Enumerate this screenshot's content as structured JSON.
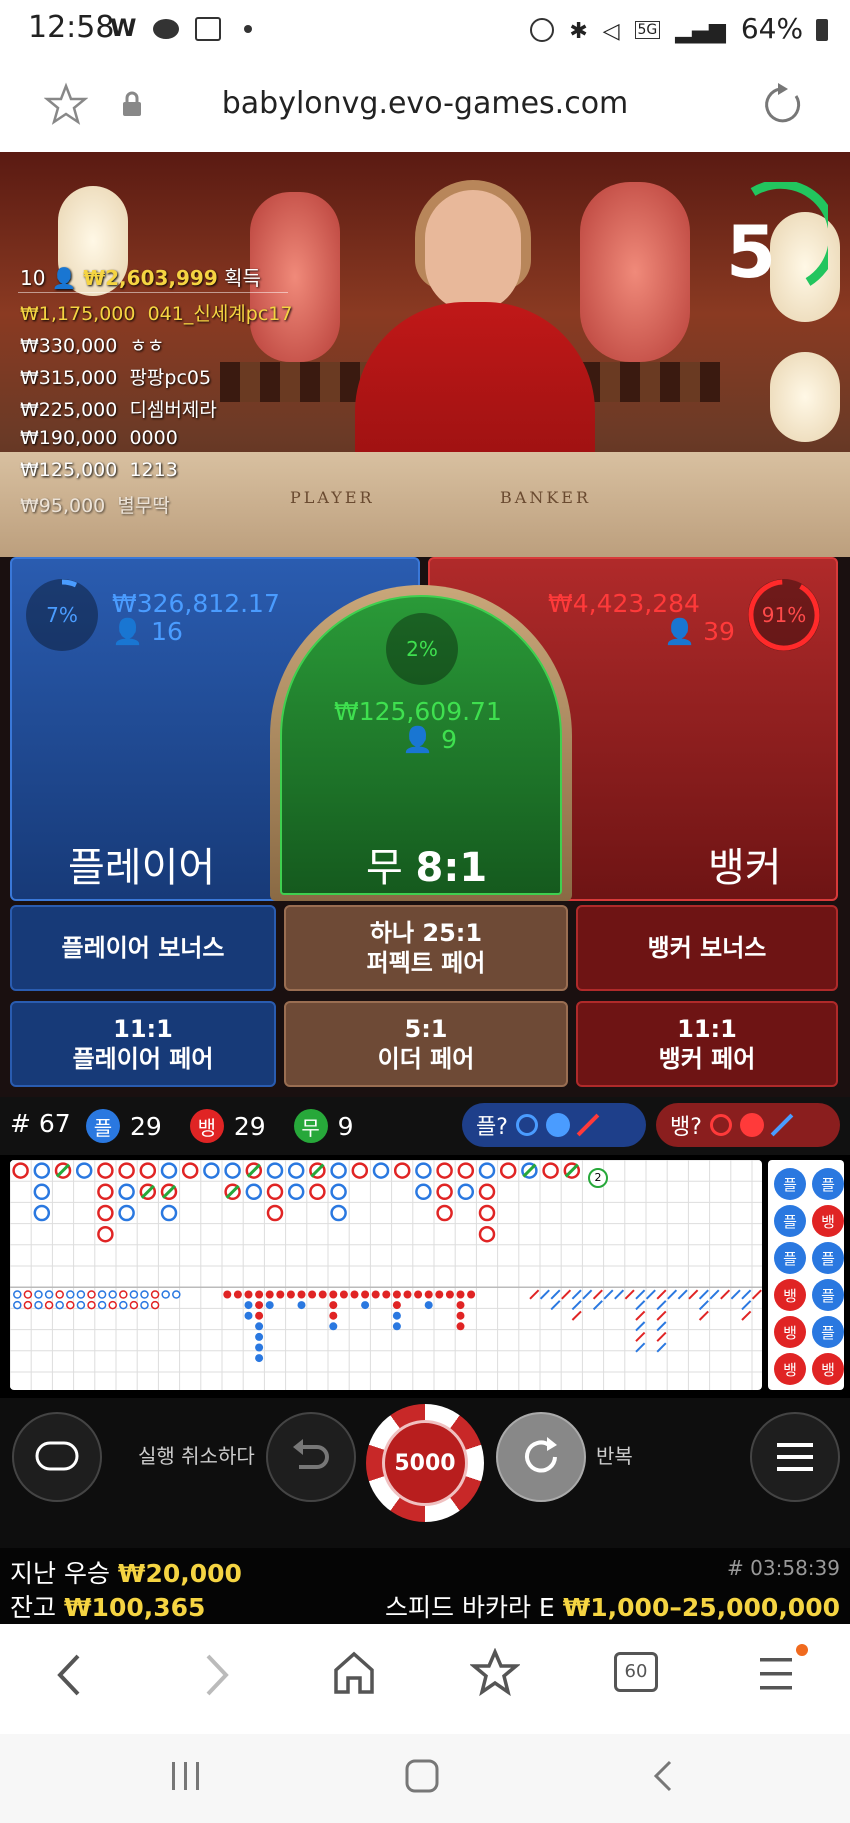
{
  "status_bar": {
    "time": "12:58",
    "notif_icons": "W",
    "battery": "64%"
  },
  "browser": {
    "url": "babylonvg.evo-games.com"
  },
  "video": {
    "countdown": "5",
    "table_left_text": "PLAYER",
    "table_right_text": "BANKER",
    "winners_header": {
      "count": "10",
      "amount": "₩2,603,999",
      "suffix": "획득"
    },
    "winners": [
      {
        "amount": "₩1,175,000",
        "name": "041_신세계pc17"
      },
      {
        "amount": "₩330,000",
        "name": "ㅎㅎ"
      },
      {
        "amount": "₩315,000",
        "name": "팡팡pc05"
      },
      {
        "amount": "₩225,000",
        "name": "디셈버제라"
      },
      {
        "amount": "₩190,000",
        "name": "0000"
      },
      {
        "amount": "₩125,000",
        "name": "1213"
      },
      {
        "amount": "₩95,000",
        "name": "별무딱"
      }
    ]
  },
  "bets": {
    "player": {
      "pct": "7%",
      "total": "₩326,812.17",
      "players": "16",
      "label": "플레이어",
      "color": "#1e4f9c"
    },
    "tie": {
      "pct": "2%",
      "total": "₩125,609.71",
      "players": "9",
      "label": "무",
      "payout": "8:1",
      "color": "#1e8a2e"
    },
    "banker": {
      "pct": "91%",
      "total": "₩4,423,284",
      "players": "39",
      "label": "뱅커",
      "color": "#9c1e1e"
    },
    "side": {
      "player_bonus": "플레이어 보너스",
      "perfect_pair_line1": "하나 25:1",
      "perfect_pair_line2": "퍼펙트 페어",
      "banker_bonus": "뱅커 보너스",
      "player_pair_line1": "11:1",
      "player_pair_line2": "플레이어 페어",
      "either_pair_line1": "5:1",
      "either_pair_line2": "이더 페어",
      "banker_pair_line1": "11:1",
      "banker_pair_line2": "뱅커 페어"
    }
  },
  "stats": {
    "round": "# 67",
    "player_badge": "플",
    "player_count": "29",
    "banker_badge": "뱅",
    "banker_count": "29",
    "tie_badge": "무",
    "tie_count": "9",
    "player_predict": "플?",
    "banker_predict": "뱅?"
  },
  "roadmap": {
    "bead_badge_label": "2",
    "side_column": [
      "플",
      "플",
      "플",
      "뱅",
      "뱅",
      "뱅"
    ],
    "side_column_2": [
      "플",
      "뱅",
      "플",
      "플",
      "플",
      "뱅"
    ]
  },
  "controls": {
    "undo_label": "실행 취소하다",
    "chip_value": "5000",
    "repeat_label": "반복"
  },
  "info": {
    "last_win_label": "지난 우승",
    "last_win_value": "₩20,000",
    "balance_label": "잔고",
    "balance_value": "₩100,365",
    "round_time": "# 03:58:39",
    "table_name": "스피드 바카라 E",
    "limits": "₩1,000–25,000,000"
  },
  "nav": {
    "tabs_count": "60"
  },
  "colors": {
    "gold": "#f5d442",
    "player_blue": "#2a78e0",
    "banker_red": "#e02424",
    "tie_green": "#27a83a"
  }
}
